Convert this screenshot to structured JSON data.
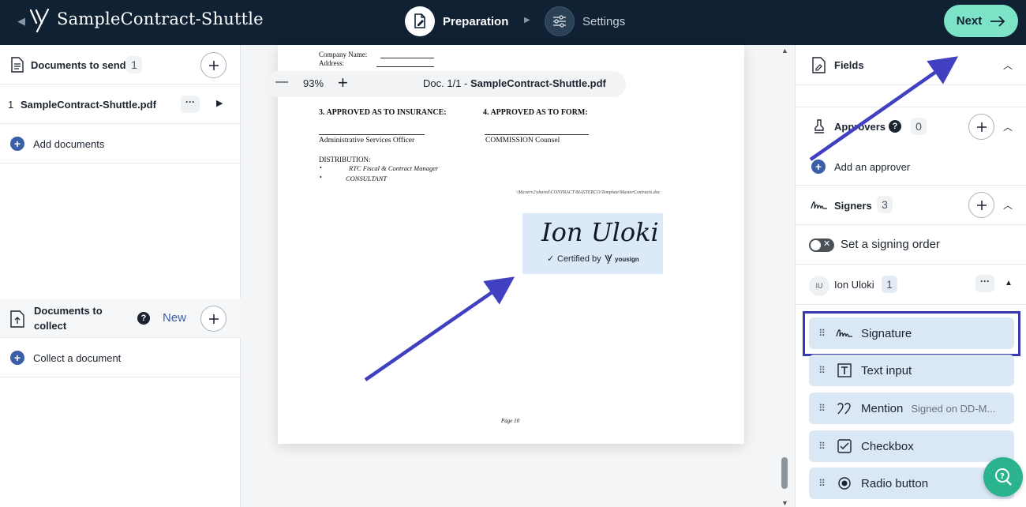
{
  "header": {
    "app_title": "SampleContract-Shuttle",
    "step1_label": "Preparation",
    "step2_label": "Settings",
    "next_label": "Next"
  },
  "left": {
    "to_send_title": "Documents to send",
    "to_send_count": "1",
    "doc_index": "1",
    "doc_name": "SampleContract-Shuttle.pdf",
    "add_documents": "Add documents",
    "collect_title_line1": "Documents to",
    "collect_title_line2": "collect",
    "collect_badge": "New",
    "collect_document": "Collect a document"
  },
  "viewer": {
    "zoom_minus": "—",
    "zoom_level": "93%",
    "zoom_plus": "+",
    "doc_prefix": "Doc. 1/1 -",
    "doc_name": "SampleContract-Shuttle.pdf",
    "company_name_label": "Company Name:",
    "address_label": "Address:",
    "approved_insurance": "3. APPROVED AS TO INSURANCE:",
    "approved_form": "4. APPROVED AS TO FORM:",
    "admin_officer": "Administrative Services Officer",
    "commission_counsel": "COMMISSION Counsel",
    "distribution_label": "DISTRIBUTION:",
    "dist_item_1": "RTC Fiscal & Contract Manager",
    "dist_item_2": "CONSULTANT",
    "file_path": "\\\\Rtcserv2\\shared\\CONTRACT\\MASTERCO\\Template\\MasterContracts.doc",
    "signature_name": "Ion Uloki",
    "certified_by": "Certified by",
    "certified_brand": "yousign",
    "page_footer": "Page 10"
  },
  "right": {
    "fields_title": "Fields",
    "approvers_title": "Approvers",
    "approvers_count": "0",
    "add_approver": "Add an approver",
    "signers_title": "Signers",
    "signers_count": "3",
    "signing_order": "Set a signing order",
    "signer_initials": "IU",
    "signer_name": "Ion Uloki",
    "signer_count": "1",
    "field_items": [
      {
        "label": "Signature",
        "hint": ""
      },
      {
        "label": "Text input",
        "hint": ""
      },
      {
        "label": "Mention",
        "hint": "Signed on DD-M..."
      },
      {
        "label": "Checkbox",
        "hint": ""
      },
      {
        "label": "Radio button",
        "hint": ""
      }
    ]
  },
  "colors": {
    "topbar": "#0f2133",
    "next_button": "#7de3c6",
    "field_item": "#dae7f5",
    "highlight": "#3a3ab0",
    "annotation_arrow": "#4040c0",
    "support": "#2bb38e"
  }
}
